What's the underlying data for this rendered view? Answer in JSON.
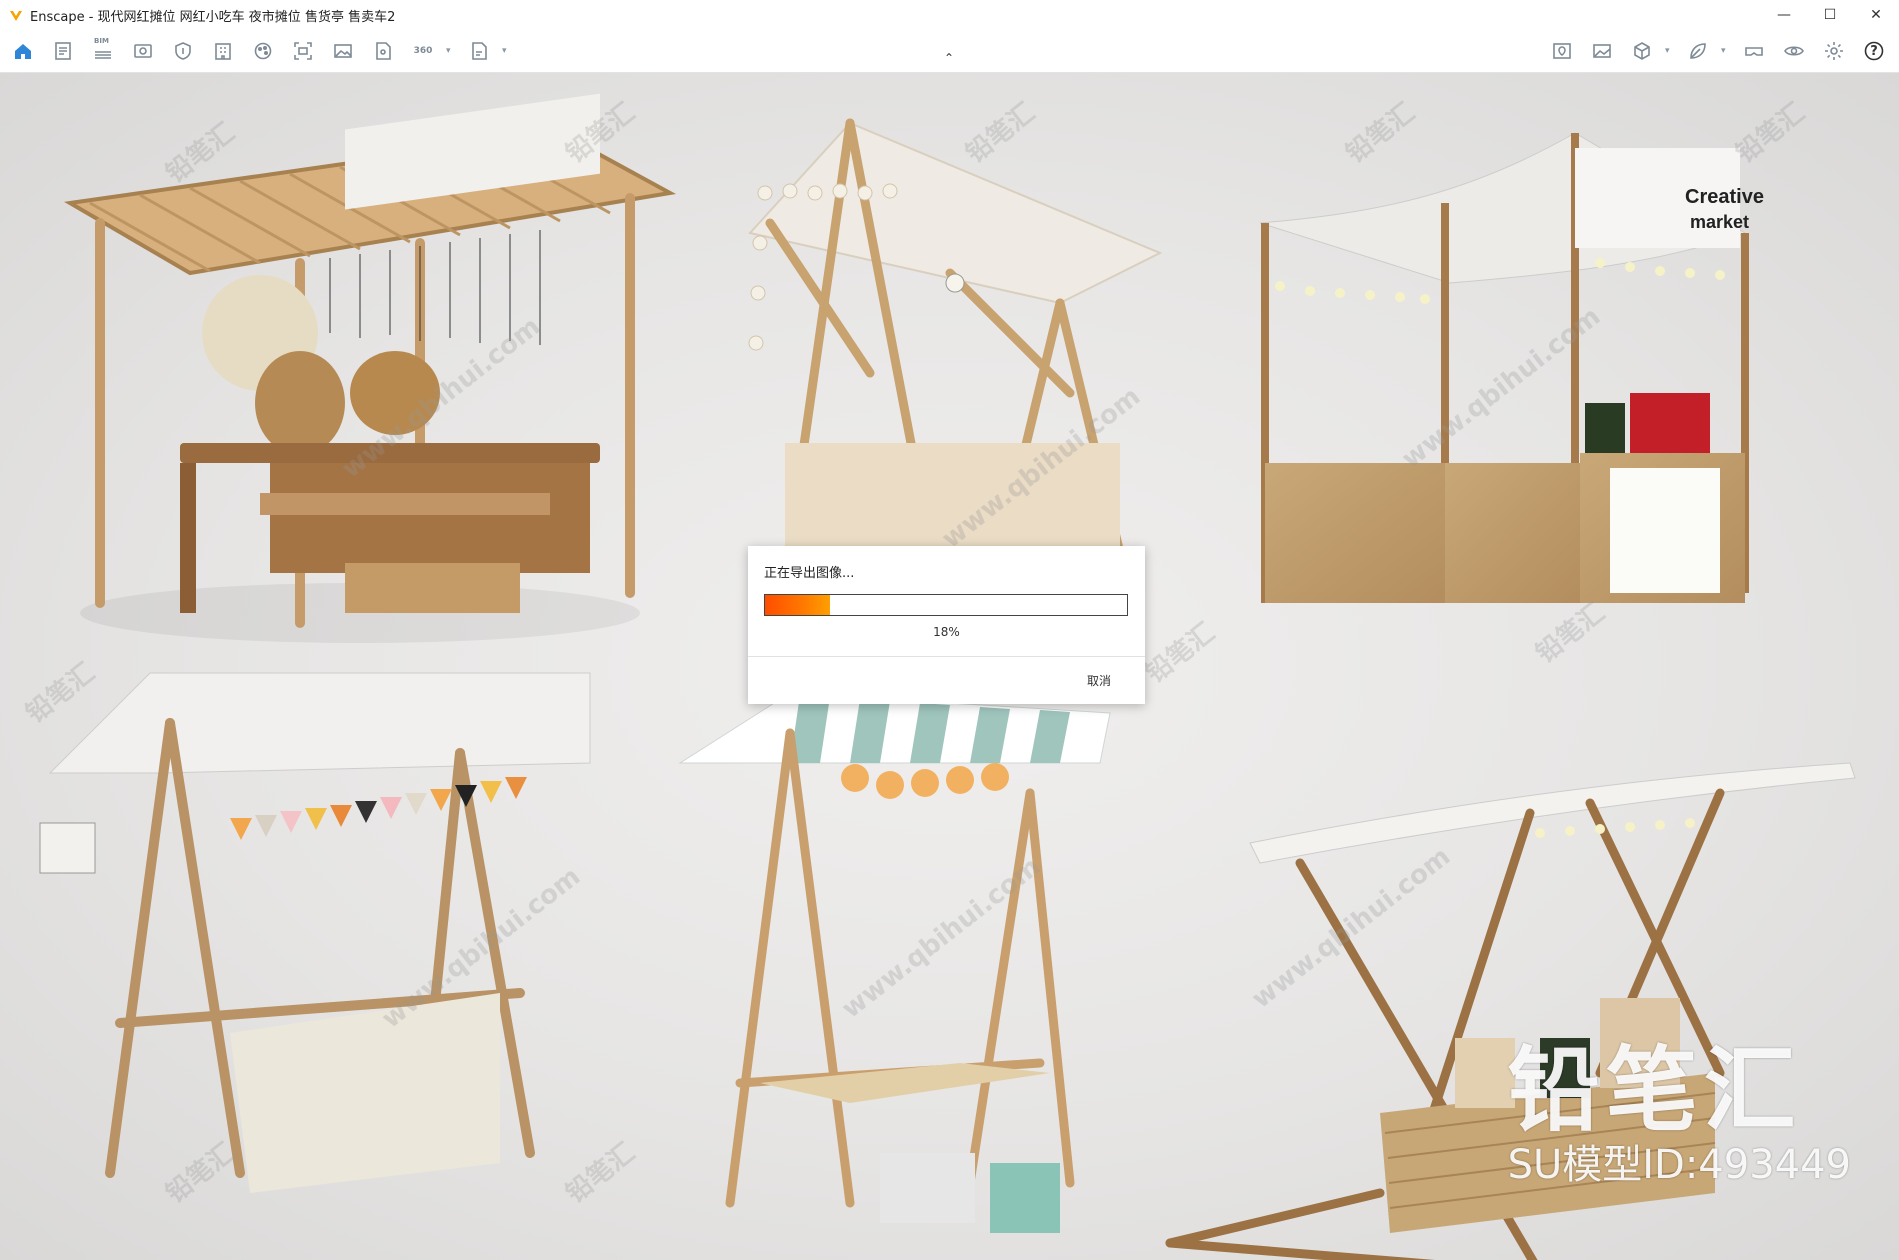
{
  "window": {
    "title": "Enscape - 现代网红摊位 网红小吃车 夜市摊位 售货亭 售卖车2",
    "controls": {
      "minimize": "—",
      "maximize": "☐",
      "close": "✕"
    }
  },
  "toolbar": {
    "left_icons": [
      "home-icon",
      "document-icon",
      "bim-icon",
      "view-icon",
      "shield-icon",
      "building-icon",
      "palette-icon",
      "capture-icon",
      "image-icon",
      "file-icon",
      "panorama-360-icon",
      "export-icon"
    ],
    "bim_label": "BIM",
    "pano_label": "360",
    "collapse_glyph": "⌃",
    "right_icons": [
      "map-pin-icon",
      "picture-icon",
      "cube-icon",
      "leaf-icon",
      "vr-headset-icon",
      "eye-icon",
      "settings-icon",
      "help-icon"
    ],
    "help_glyph": "?",
    "accent_color": "#2f86d6",
    "icon_color": "#7d8a96"
  },
  "viewport": {
    "watermark_text": "www.qbihui.com",
    "watermark_cn": "铅笔汇",
    "brand_big": "铅笔汇",
    "brand_id": "SU模型ID:493449"
  },
  "export_dialog": {
    "title": "正在导出图像...",
    "progress": 0.18,
    "progress_label": "18%",
    "cancel_label": "取消",
    "progress_color": "#ff6a00"
  }
}
